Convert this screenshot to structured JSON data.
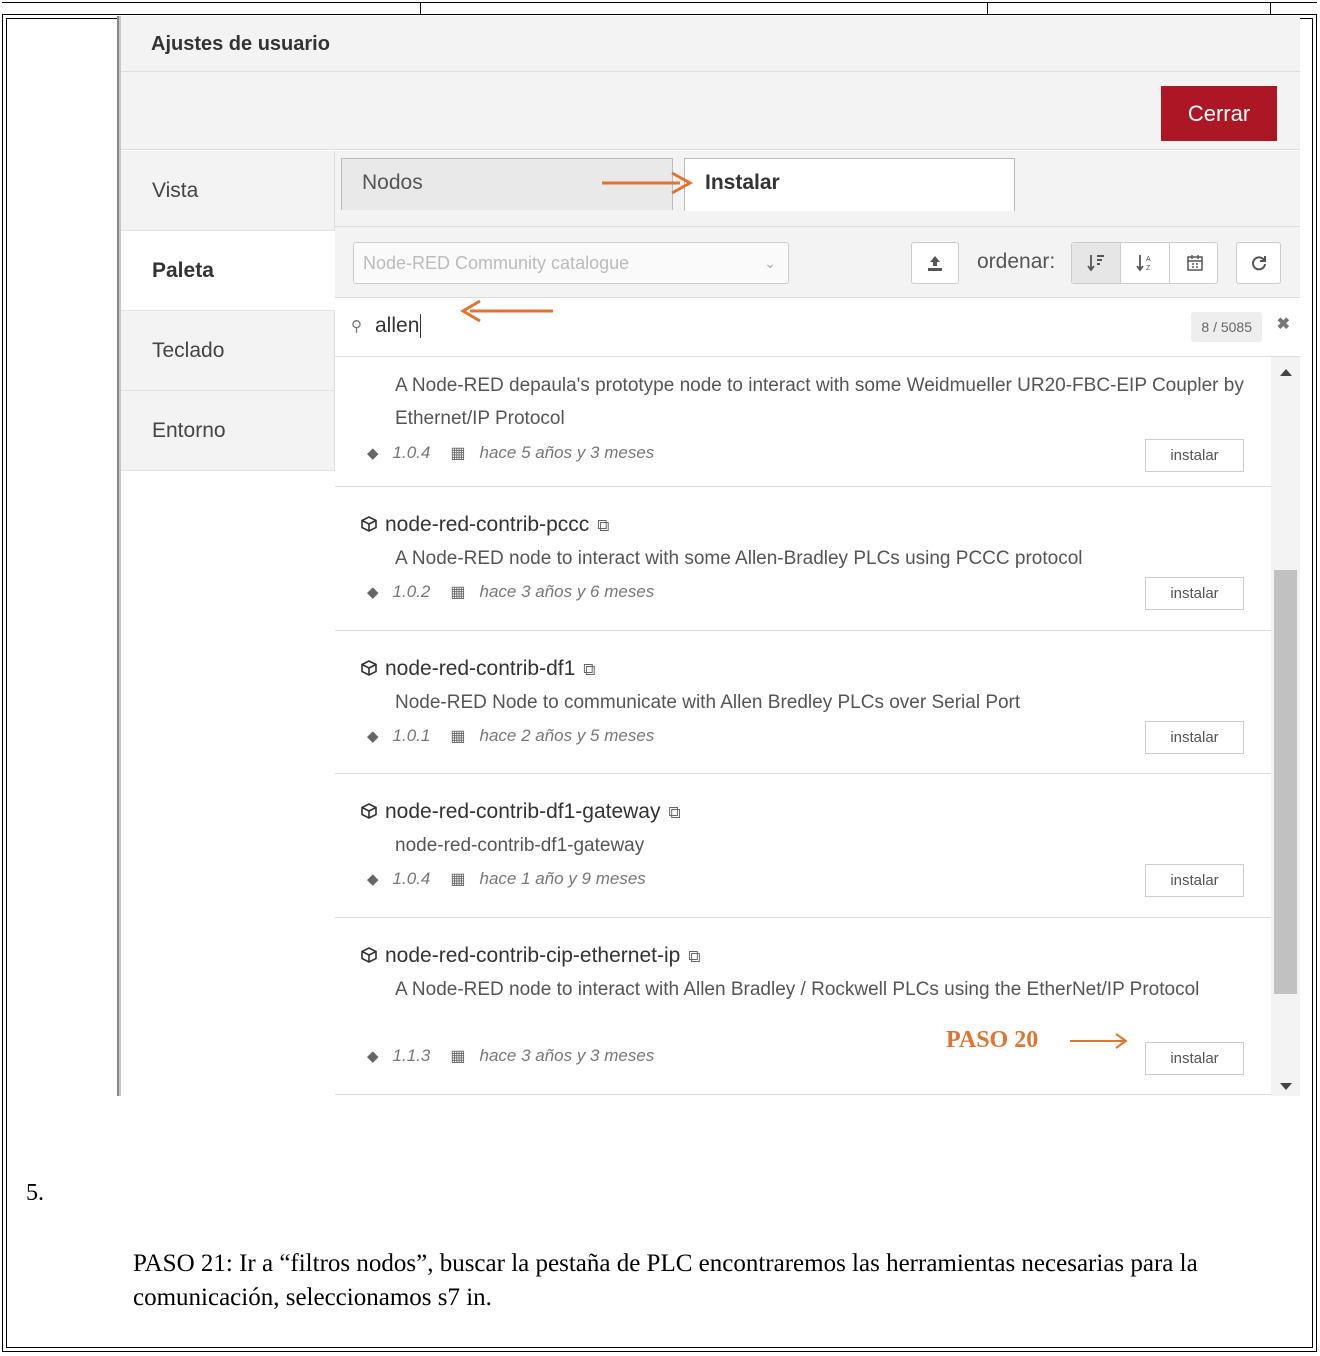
{
  "dialog": {
    "title": "Ajustes de usuario",
    "close_label": "Cerrar"
  },
  "nav": {
    "items": [
      {
        "label": "Vista"
      },
      {
        "label": "Paleta"
      },
      {
        "label": "Teclado"
      },
      {
        "label": "Entorno"
      }
    ],
    "active": "Paleta"
  },
  "tabs": {
    "nodos": "Nodos",
    "instalar": "Instalar",
    "active": "Instalar"
  },
  "toolbar": {
    "catalog_selected": "Node-RED Community catalogue",
    "sort_label": "ordenar:",
    "upload_icon": "upload-icon",
    "sort_icons": [
      "sort-alpha-icon",
      "sort-az-icon",
      "calendar-icon"
    ],
    "refresh_icon": "refresh-icon"
  },
  "search": {
    "value": "allen",
    "count": "8 / 5085"
  },
  "packages": [
    {
      "name": "",
      "description": "A Node-RED depaula's prototype node to interact with some Weidmueller UR20-FBC-EIP Coupler by Ethernet/IP Protocol",
      "version": "1.0.4",
      "updated": "hace 5 años y 3 meses",
      "install_label": "instalar"
    },
    {
      "name": "node-red-contrib-pccc",
      "description": "A Node-RED node to interact with some Allen-Bradley PLCs using PCCC protocol",
      "version": "1.0.2",
      "updated": "hace 3 años y 6 meses",
      "install_label": "instalar"
    },
    {
      "name": "node-red-contrib-df1",
      "description": "Node-RED Node to communicate with Allen Bredley PLCs over Serial Port",
      "version": "1.0.1",
      "updated": "hace 2 años y 5 meses",
      "install_label": "instalar"
    },
    {
      "name": "node-red-contrib-df1-gateway",
      "description": "node-red-contrib-df1-gateway",
      "version": "1.0.4",
      "updated": "hace 1 año y 9 meses",
      "install_label": "instalar"
    },
    {
      "name": "node-red-contrib-cip-ethernet-ip",
      "description": "A Node-RED node to interact with Allen Bradley / Rockwell PLCs using the EtherNet/IP Protocol",
      "version": "1.1.3",
      "updated": "hace 3 años y 3 meses",
      "install_label": "instalar"
    }
  ],
  "annotations": {
    "step20": "PASO 20",
    "arrow_color": "#e07430"
  },
  "document": {
    "number": "5.",
    "paragraph": "PASO 21: Ir a “filtros nodos”, buscar la pestaña de PLC encontraremos las herramientas necesarias para la comunicación, seleccionamos s7 in."
  },
  "colors": {
    "close_button": "#ad1625",
    "panel_bg": "#f3f3f3"
  }
}
